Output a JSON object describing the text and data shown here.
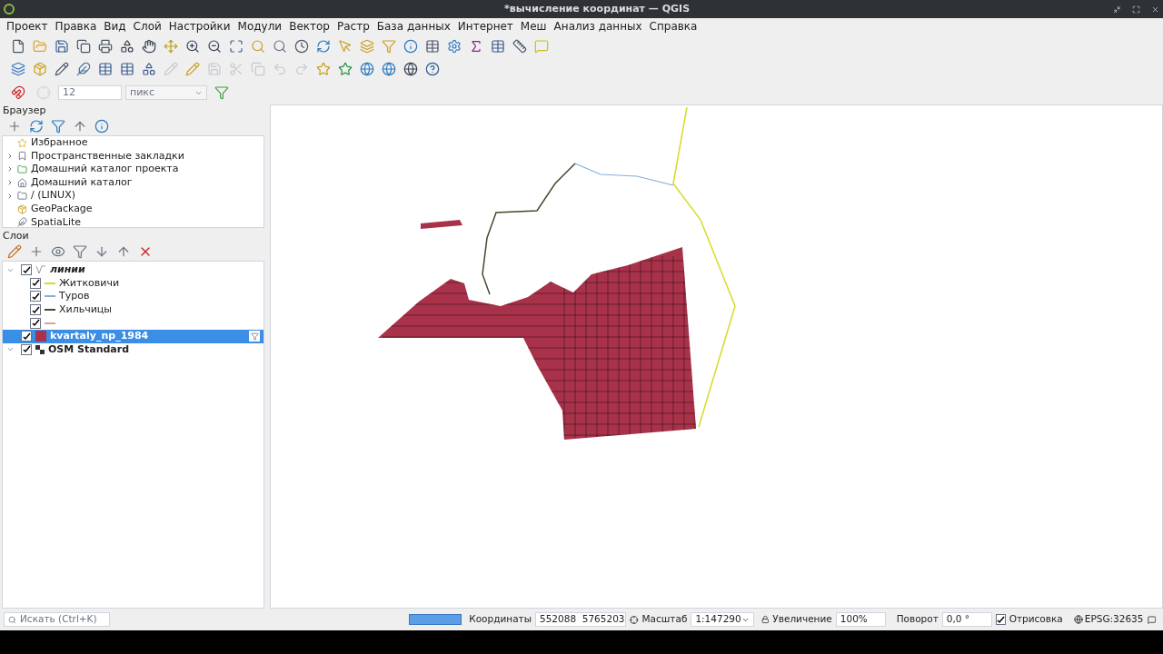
{
  "window": {
    "title": "*вычисление координат — QGIS"
  },
  "menu": [
    "Проект",
    "Правка",
    "Вид",
    "Слой",
    "Настройки",
    "Модули",
    "Вектор",
    "Растр",
    "База данных",
    "Интернет",
    "Меш",
    "Анализ данных",
    "Справка"
  ],
  "snapping": {
    "value": "12",
    "unit": "пикс"
  },
  "browser": {
    "title": "Браузер",
    "items": [
      {
        "label": "Избранное",
        "expandable": false,
        "kind": "star"
      },
      {
        "label": "Пространственные закладки",
        "expandable": true,
        "kind": "bookmark"
      },
      {
        "label": "Домашний каталог проекта",
        "expandable": true,
        "kind": "project"
      },
      {
        "label": "Домашний каталог",
        "expandable": true,
        "kind": "home"
      },
      {
        "label": "/ (LINUX)",
        "expandable": true,
        "kind": "folder"
      },
      {
        "label": "GeoPackage",
        "expandable": false,
        "kind": "geopackage"
      },
      {
        "label": "SpatiaLite",
        "expandable": false,
        "kind": "spatialite"
      }
    ]
  },
  "layers": {
    "title": "Слои",
    "items": [
      {
        "label": "линии",
        "kind": "group",
        "checked": true,
        "expanded": true,
        "selected": false,
        "children": [
          {
            "label": "Житковичи",
            "kind": "line",
            "checked": true,
            "color": "#d9d92a"
          },
          {
            "label": "Туров",
            "kind": "line",
            "checked": true,
            "color": "#7fb0dc"
          },
          {
            "label": "Хильчицы",
            "kind": "line",
            "checked": true,
            "color": "#3e4d2c"
          },
          {
            "kind": "line",
            "checked": true,
            "color": "#c9ab93"
          }
        ]
      },
      {
        "label": "kvartaly_np_1984",
        "kind": "polygon",
        "checked": true,
        "selected": true,
        "color": "#a8324a"
      },
      {
        "label": "OSM Standard",
        "kind": "raster",
        "checked": true,
        "expanded": true,
        "selected": false
      }
    ]
  },
  "status_bar": {
    "search_placeholder": "Искать (Ctrl+K)",
    "progress": {
      "level": 1
    },
    "coordinates_label": "Координаты",
    "coordinates": "552088  5765203",
    "scale_label": "Масштаб",
    "scale": "1:147290",
    "magnifier_label": "Увеличение",
    "magnifier": "100%",
    "rotation_label": "Поворот",
    "rotation": "0,0 °",
    "render": {
      "label": "Отрисовка",
      "checked": true
    },
    "crs": "EPSG:32635"
  }
}
